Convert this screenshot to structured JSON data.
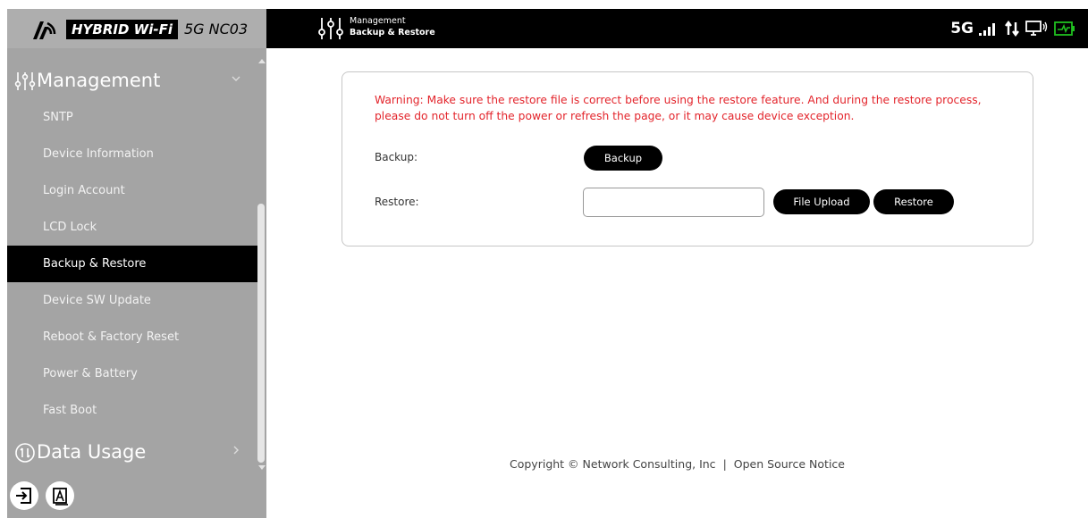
{
  "brand": {
    "badge": "HYBRID Wi-Fi",
    "model": "5G NC03"
  },
  "sidebar": {
    "section_management": "Management",
    "items": [
      {
        "label": "SNTP"
      },
      {
        "label": "Device Information"
      },
      {
        "label": "Login Account"
      },
      {
        "label": "LCD Lock"
      },
      {
        "label": "Backup & Restore",
        "active": true
      },
      {
        "label": "Device SW Update"
      },
      {
        "label": "Reboot & Factory Reset"
      },
      {
        "label": "Power & Battery"
      },
      {
        "label": "Fast Boot"
      }
    ],
    "section_data_usage": "Data Usage"
  },
  "header": {
    "breadcrumb_parent": "Management",
    "breadcrumb_current": "Backup & Restore",
    "network": "5G"
  },
  "main": {
    "warning": "Warning: Make sure the restore file is correct before using the restore feature. And during the restore process, please do not turn off the power or refresh the page, or it may cause device exception.",
    "backup_label": "Backup:",
    "backup_button": "Backup",
    "restore_label": "Restore:",
    "file_input_value": "",
    "file_upload_button": "File Upload",
    "restore_button": "Restore"
  },
  "footer": {
    "copyright": "Copyright © Network Consulting, Inc",
    "separator": "|",
    "open_source": "Open Source Notice"
  },
  "colors": {
    "sidebar_bg": "#a4a4a4",
    "header_bg": "#000000",
    "warning": "#e3242b",
    "battery": "#20c020"
  }
}
